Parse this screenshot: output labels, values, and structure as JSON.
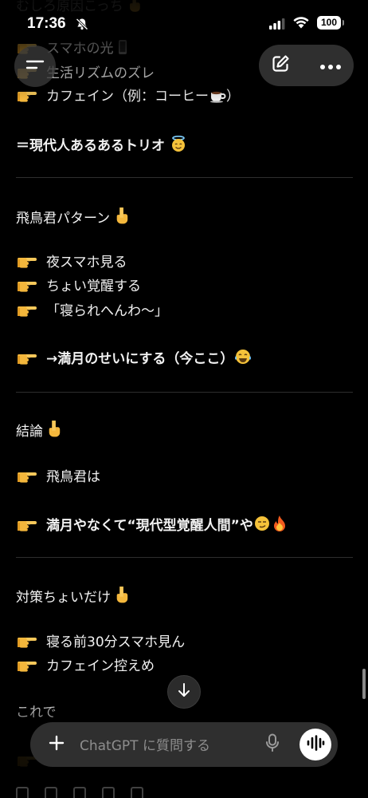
{
  "status_bar": {
    "time": "17:36",
    "battery": "100"
  },
  "conversation": {
    "top_line": "むしろ原因こっち",
    "causes": [
      {
        "text": "スマホの光",
        "emoji": "phone"
      },
      {
        "text": "生活リズムのズレ"
      },
      {
        "text": "カフェイン（例：コーヒー",
        "emoji": "coffee",
        "suffix": "）"
      }
    ],
    "trio_summary": "＝現代人あるあるトリオ",
    "section_asuka": {
      "heading": "飛鳥君パターン",
      "items": [
        "夜スマホ見る",
        "ちょい覚醒する",
        "「寝られへんわ〜」"
      ],
      "conclusion": "→満月のせいにする（今ここ）"
    },
    "section_result": {
      "heading": "結論",
      "item1": "飛鳥君は",
      "item2": "満月やなくて“現代型覚醒人間”や"
    },
    "section_tips": {
      "heading": "対策ちょいだけ",
      "items": [
        "寝る前30分スマホ見ん",
        "カフェイン控えめ"
      ],
      "closing": "これで"
    }
  },
  "composer": {
    "placeholder": "ChatGPT に質問する"
  },
  "icons": {
    "menu": "menu-icon",
    "compose": "compose-icon",
    "more": "more-icon",
    "scroll_down": "arrow-down-icon",
    "plus": "plus-icon",
    "mic": "mic-icon",
    "voice": "voice-waveform-icon",
    "pointing": "pointing-right-emoji"
  },
  "colors": {
    "background": "#000000",
    "text": "#f2f2f2",
    "divider": "#2e2e2e",
    "composer": "#2f2f2f",
    "placeholder": "#8e8e8e"
  }
}
